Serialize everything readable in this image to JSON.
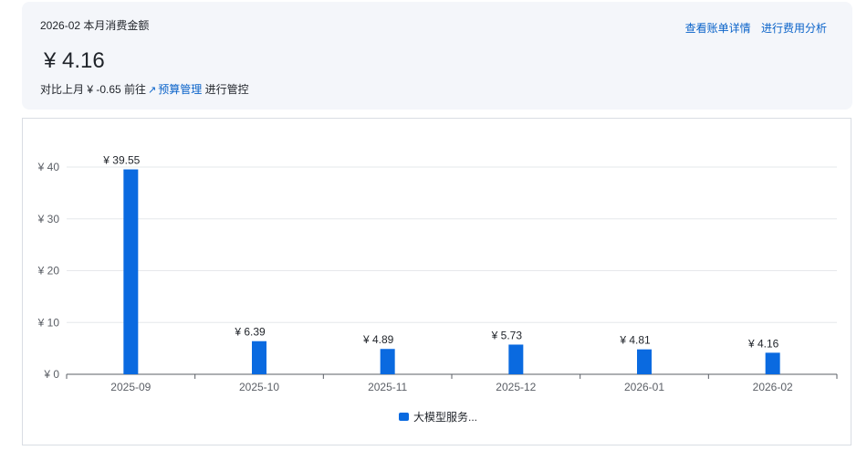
{
  "summary": {
    "period_label": "2026-02 本月消费金额",
    "amount": "¥ 4.16",
    "compare_text": "对比上月 ¥ -0.65 前往",
    "budget_link": "预算管理",
    "compare_suffix": " 进行管控",
    "link_icon": "external-arrow-icon"
  },
  "header_links": {
    "bill_details": "查看账单详情",
    "cost_analysis": "进行费用分析"
  },
  "colors": {
    "bar": "#0a6ae0",
    "link": "#0a63c9",
    "grid": "#e6e8eb",
    "axis": "#5b5f66"
  },
  "chart_data": {
    "type": "bar",
    "categories": [
      "2025-09",
      "2025-10",
      "2025-11",
      "2025-12",
      "2026-01",
      "2026-02"
    ],
    "series": [
      {
        "name": "大模型服务...",
        "values": [
          39.55,
          6.39,
          4.89,
          5.73,
          4.81,
          4.16
        ]
      }
    ],
    "data_labels": [
      "¥ 39.55",
      "¥ 6.39",
      "¥ 4.89",
      "¥ 5.73",
      "¥ 4.81",
      "¥ 4.16"
    ],
    "y_ticks": [
      0,
      10,
      20,
      30,
      40
    ],
    "y_tick_labels": [
      "¥ 0",
      "¥ 10",
      "¥ 20",
      "¥ 30",
      "¥ 40"
    ],
    "ylim": [
      0,
      40
    ],
    "grid": true,
    "legend_position": "bottom-center"
  }
}
